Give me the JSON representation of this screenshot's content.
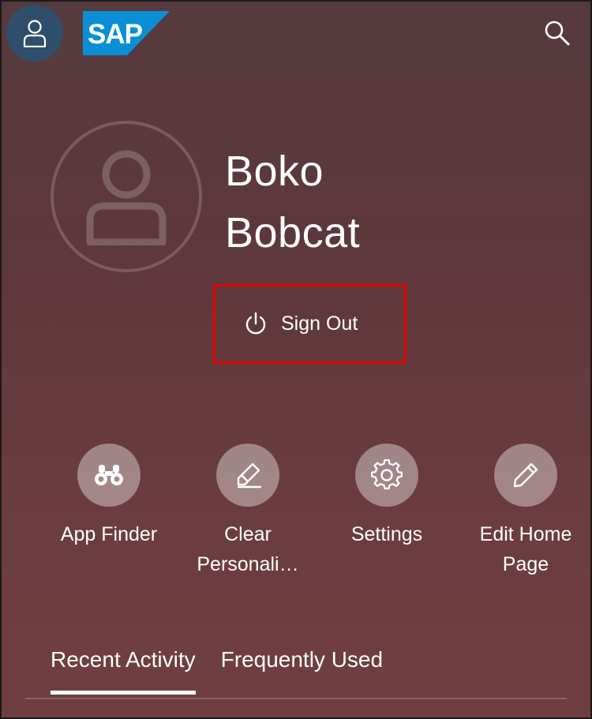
{
  "header": {
    "logo_text": "SAP",
    "brand_color": "#0a8fd6",
    "avatar_bg": "#2f4e6c",
    "icons": [
      "user-icon",
      "search-icon"
    ]
  },
  "profile": {
    "first_name": "Boko",
    "last_name": "Bobcat",
    "sign_out_label": "Sign Out",
    "highlight_color": "#e60000"
  },
  "actions": [
    {
      "label": "App Finder",
      "icon": "binoculars-icon"
    },
    {
      "label": "Clear Personali…",
      "icon": "eraser-icon"
    },
    {
      "label": "Settings",
      "icon": "gear-icon"
    },
    {
      "label": "Edit Home Page",
      "icon": "pencil-icon"
    }
  ],
  "tabs": [
    {
      "label": "Recent Activity",
      "active": true
    },
    {
      "label": "Frequently Used",
      "active": false
    }
  ]
}
